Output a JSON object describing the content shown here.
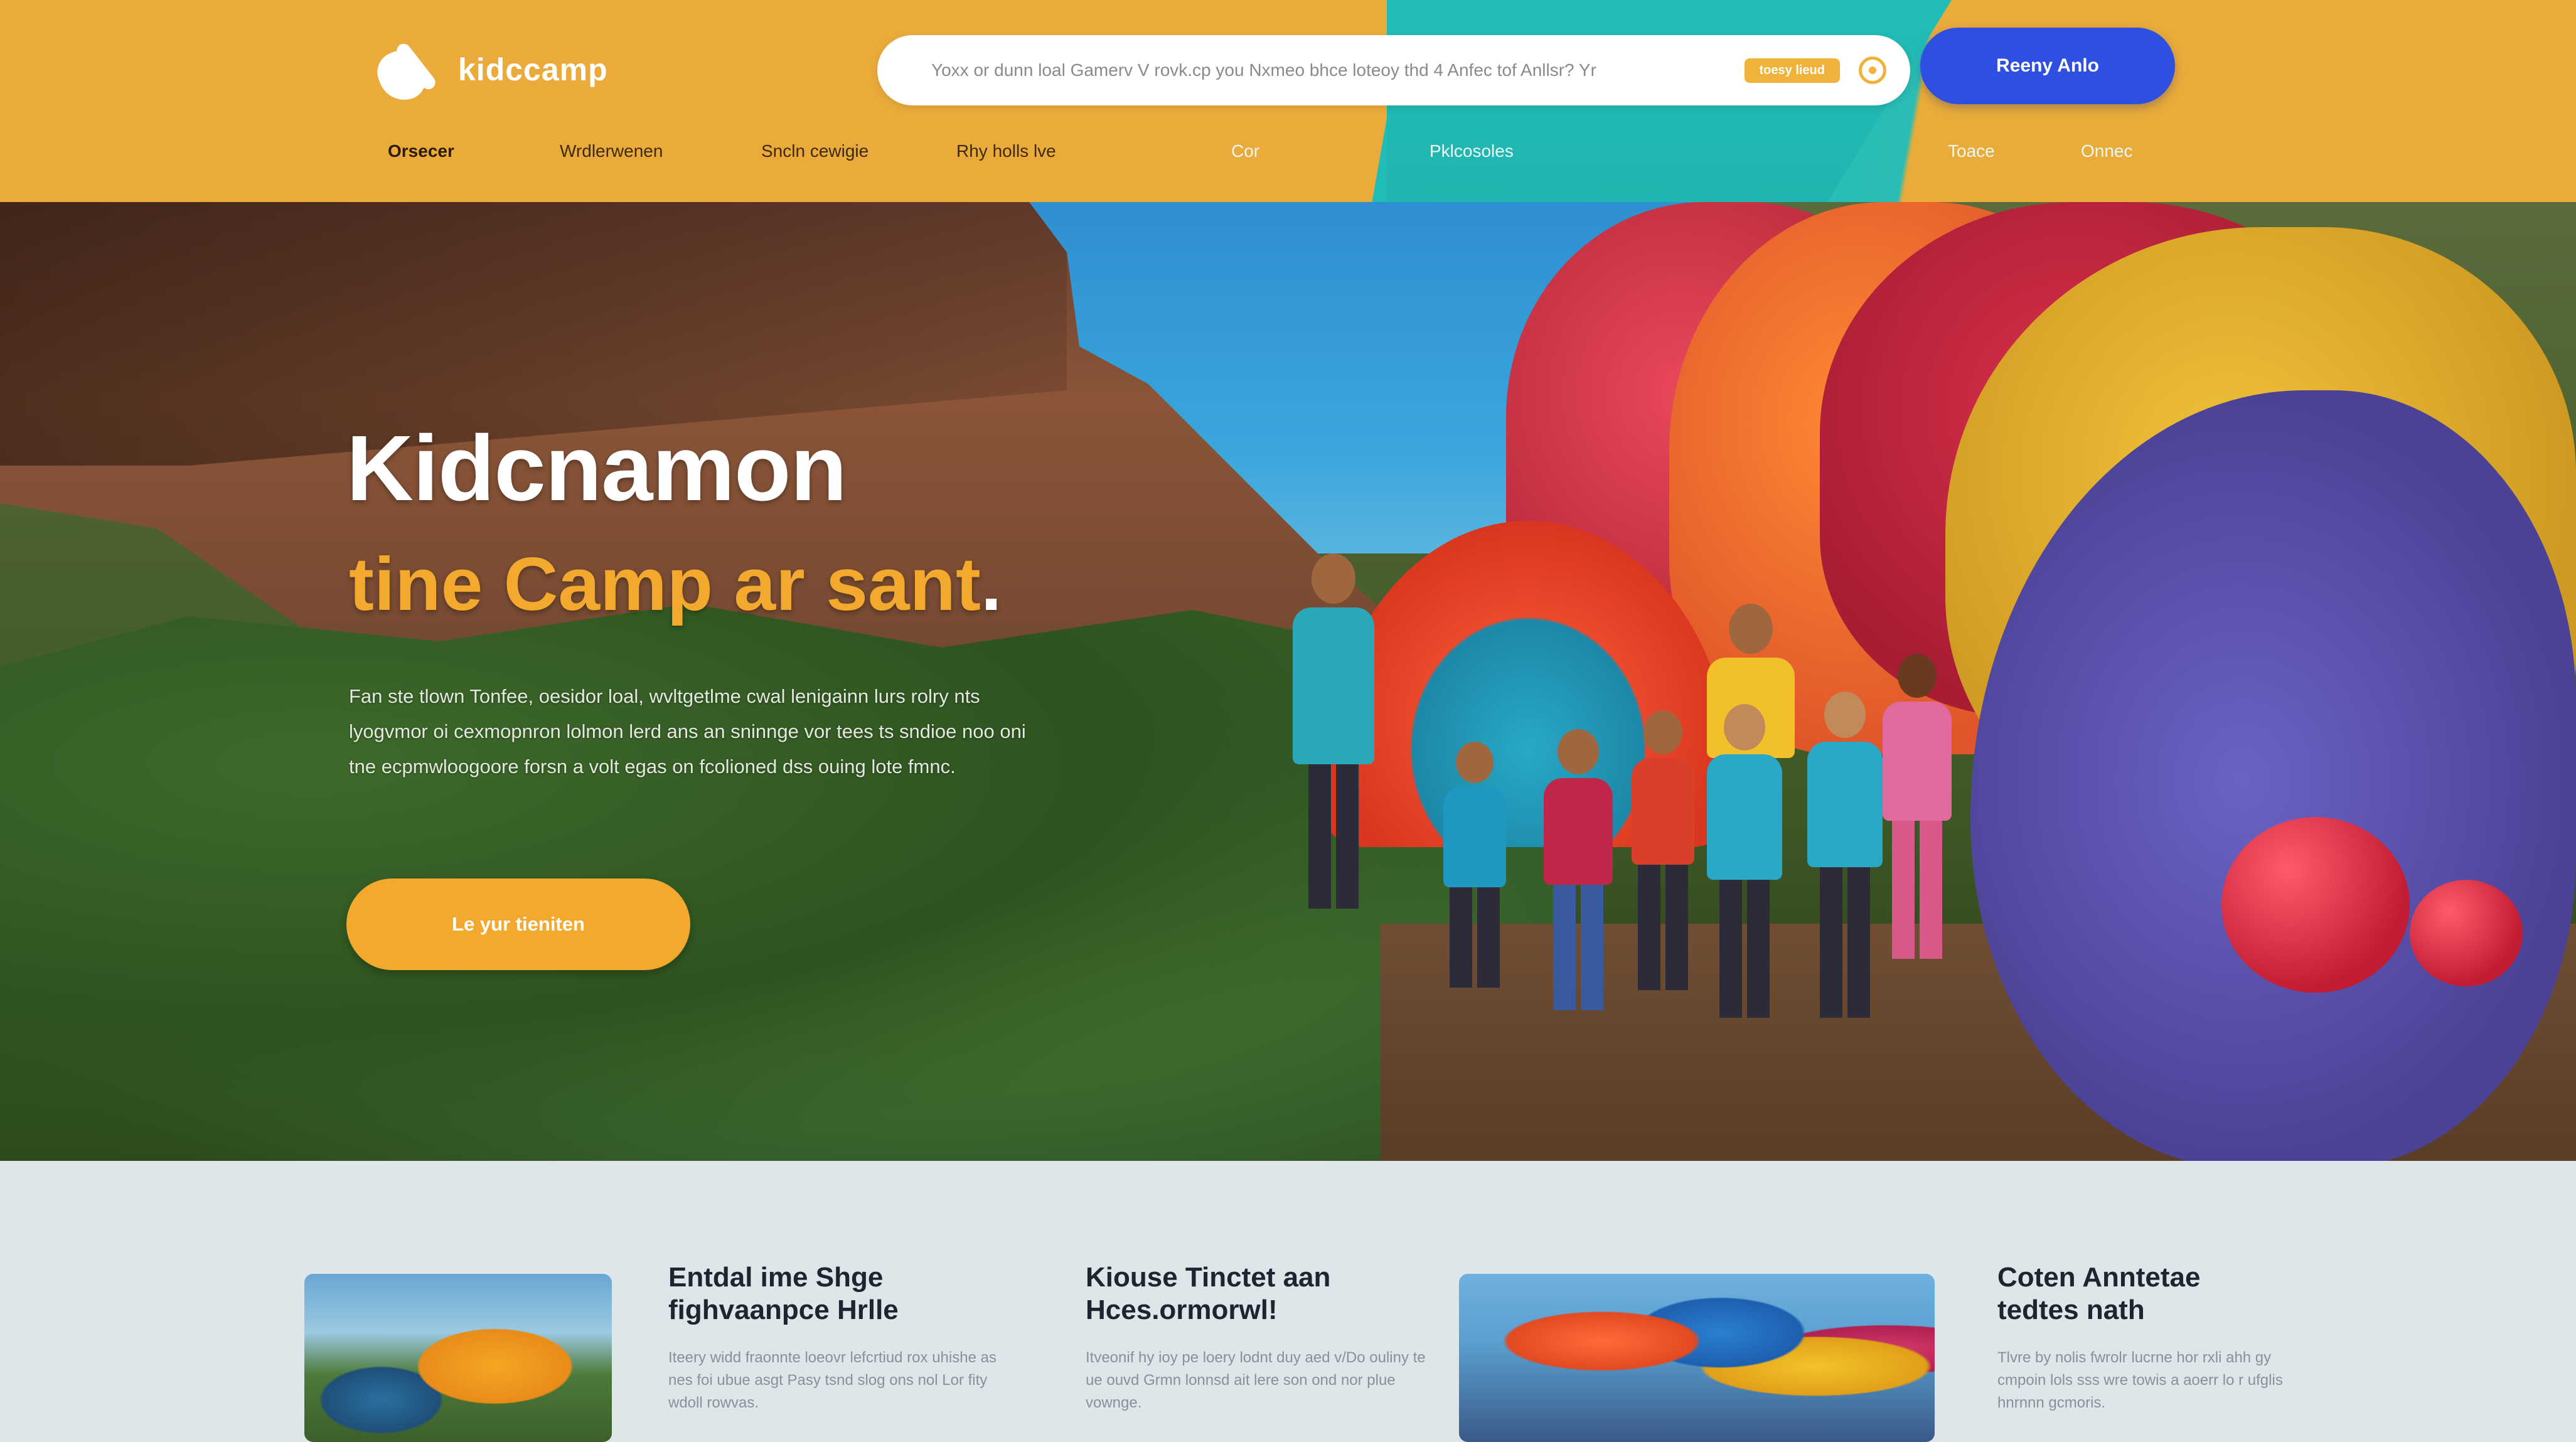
{
  "header": {
    "logo_text": "kidccamp",
    "search": {
      "value": "Yoxx or dunn loal Gamerv V rovk.cp you Nxmeo bhce loteoy thd 4 Anfec tof Anllsr? Yr",
      "tag": "toesy lieud"
    },
    "cta_label": "Reeny Anlo",
    "nav": [
      {
        "label": "Orsecer"
      },
      {
        "label": "Wrdlerwenen"
      },
      {
        "label": "Sncln cewigie"
      },
      {
        "label": "Rhy holls lve"
      },
      {
        "label": "Cor"
      },
      {
        "label": "Pklcosoles"
      },
      {
        "label": "Toace"
      },
      {
        "label": "Onnec"
      }
    ]
  },
  "hero": {
    "title": "Kidcnamon",
    "subtitle": "tine Camp ar sant",
    "subtitle_dot": ".",
    "description": "Fan ste tlown Tonfee, oesidor loal, wvltgetlme cwal lenigainn lurs rolry nts lyogvmor oi cexmopnron lolmon lerd ans an sninnge vor tees ts sndioe noo oni tne ecpmwloogoore forsn a volt egas on fcolioned dss ouing lote fmnc.",
    "cta_label": "Le yur tieniten"
  },
  "cards": [
    {
      "title_line1": "Entdal ime Shge",
      "title_line2": "fighvaanpce Hrlle",
      "text": "Iteery widd fraonnte loeovr lefcrtiud rox uhishe as nes foi ubue asgt Pasy tsnd slog ons nol Lor fity wdoll rowvas."
    },
    {
      "title_line1": "Kiouse Tinctet aan",
      "title_line2": "Hces.ormorwl!",
      "text": "Itveonif hy ioy pe loery lodnt duy aed v/Do ouliny te ue ouvd Grmn lonnsd ait lere son ond nor plue vownge."
    },
    {
      "title_line1": "Coten Anntetae",
      "title_line2": "tedtes nath",
      "text": "Tlvre by nolis fwrolr lucrne hor rxli ahh gy cmpoin lols sss wre towis a aoerr lo r ufglis hnrnnn gcmoris."
    }
  ]
}
